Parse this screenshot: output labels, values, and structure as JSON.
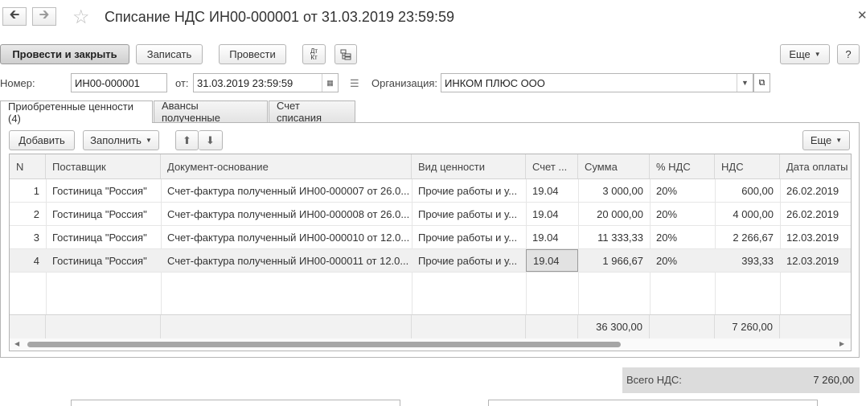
{
  "window": {
    "title": "Списание НДС ИН00-000001 от 31.03.2019 23:59:59"
  },
  "toolbar": {
    "post_close": "Провести и закрыть",
    "save": "Записать",
    "post": "Провести",
    "dtkt": "Дт Кт",
    "more": "Еще",
    "help": "?"
  },
  "form": {
    "number_label": "Номер:",
    "number": "ИН00-000001",
    "date_label": "от:",
    "date": "31.03.2019 23:59:59",
    "org_label": "Организация:",
    "org": "ИНКОМ ПЛЮС ООО"
  },
  "tabs": [
    {
      "label": "Приобретенные ценности (4)"
    },
    {
      "label": "Авансы полученные"
    },
    {
      "label": "Счет списания"
    }
  ],
  "table_toolbar": {
    "add": "Добавить",
    "fill": "Заполнить",
    "more": "Еще"
  },
  "table": {
    "columns": [
      "N",
      "Поставщик",
      "Документ-основание",
      "Вид ценности",
      "Счет ...",
      "Сумма",
      "% НДС",
      "НДС",
      "Дата оплаты"
    ],
    "rows": [
      [
        "1",
        "Гостиница \"Россия\"",
        "Счет-фактура полученный ИН00-000007 от 26.0...",
        "Прочие работы и у...",
        "19.04",
        "3 000,00",
        "20%",
        "600,00",
        "26.02.2019"
      ],
      [
        "2",
        "Гостиница \"Россия\"",
        "Счет-фактура полученный ИН00-000008 от 26.0...",
        "Прочие работы и у...",
        "19.04",
        "20 000,00",
        "20%",
        "4 000,00",
        "26.02.2019"
      ],
      [
        "3",
        "Гостиница \"Россия\"",
        "Счет-фактура полученный ИН00-000010 от 12.0...",
        "Прочие работы и у...",
        "19.04",
        "11 333,33",
        "20%",
        "2 266,67",
        "12.03.2019"
      ],
      [
        "4",
        "Гостиница \"Россия\"",
        "Счет-фактура полученный ИН00-000011 от 12.0...",
        "Прочие работы и у...",
        "19.04",
        "1 966,67",
        "20%",
        "393,33",
        "12.03.2019"
      ]
    ],
    "totals": {
      "sum": "36 300,00",
      "vat": "7 260,00"
    }
  },
  "summary": {
    "label": "Всего НДС:",
    "value": "7 260,00"
  }
}
